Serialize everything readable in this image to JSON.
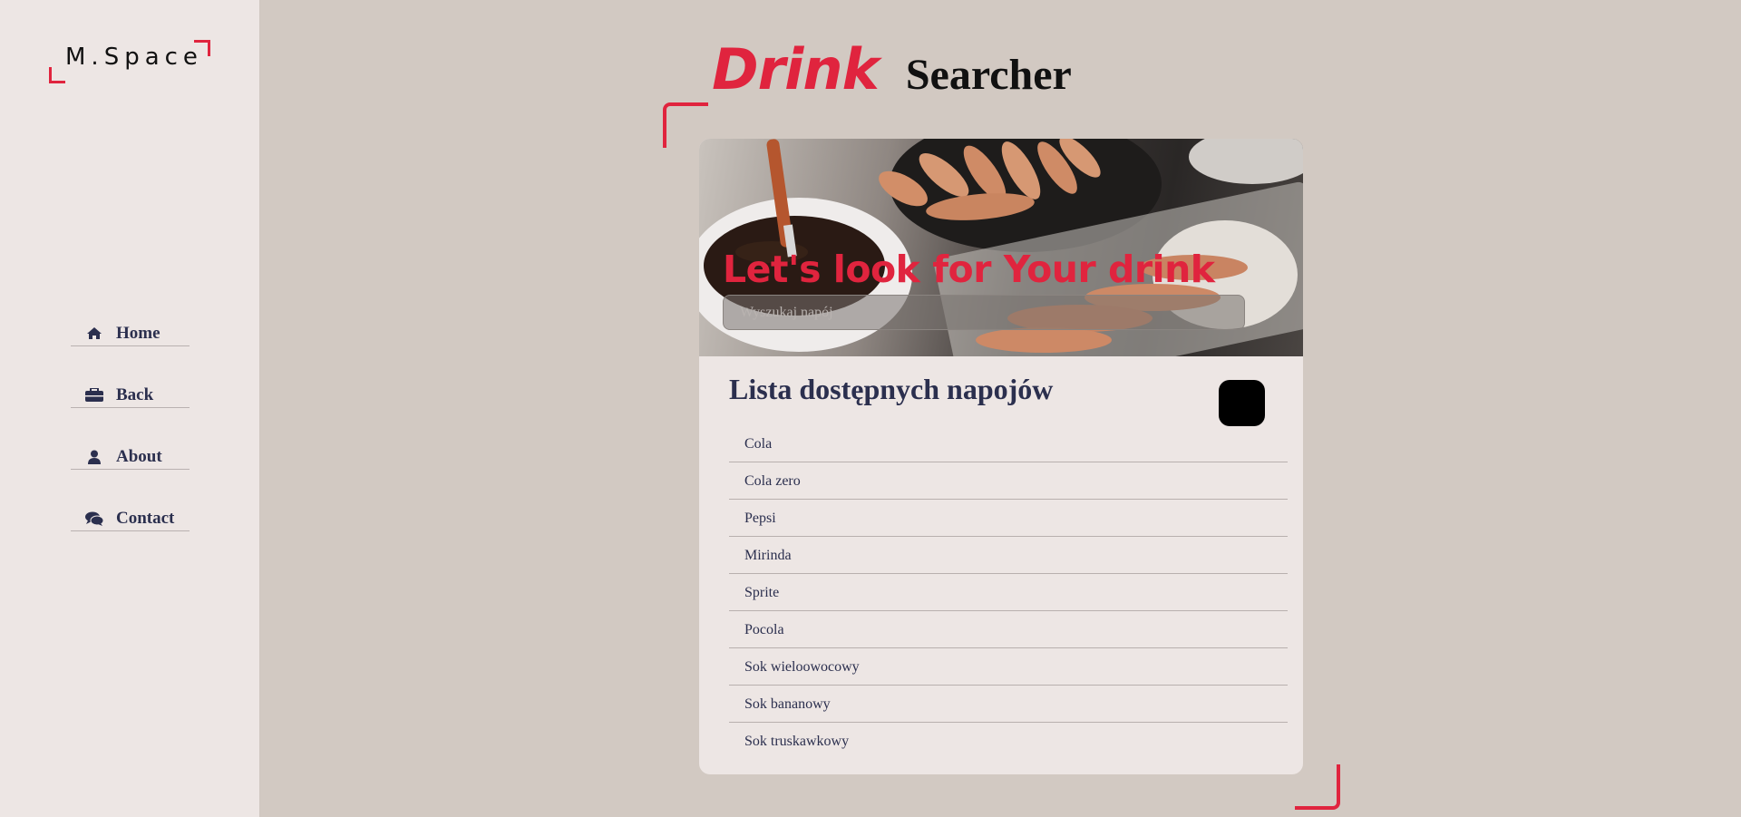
{
  "logo": {
    "text": "M.Space"
  },
  "nav": {
    "items": [
      {
        "label": "Home",
        "icon": "home-icon"
      },
      {
        "label": "Back",
        "icon": "briefcase-icon"
      },
      {
        "label": "About",
        "icon": "user-icon"
      },
      {
        "label": "Contact",
        "icon": "comments-icon"
      }
    ]
  },
  "title": {
    "accent": "Drink",
    "rest": "Searcher"
  },
  "hero": {
    "heading": "Let's look for Your drink",
    "search_placeholder": "Wyszukaj napój"
  },
  "list": {
    "title": "Lista dostępnych napojów",
    "items": [
      "Cola",
      "Cola zero",
      "Pepsi",
      "Mirinda",
      "Sprite",
      "Pocola",
      "Sok wieloowocowy",
      "Sok bananowy",
      "Sok truskawkowy"
    ]
  },
  "colors": {
    "accent": "#e0243e",
    "sidebar_bg": "#ede6e4",
    "page_bg": "#d2c9c2",
    "text_dark": "#2b2f4e"
  }
}
